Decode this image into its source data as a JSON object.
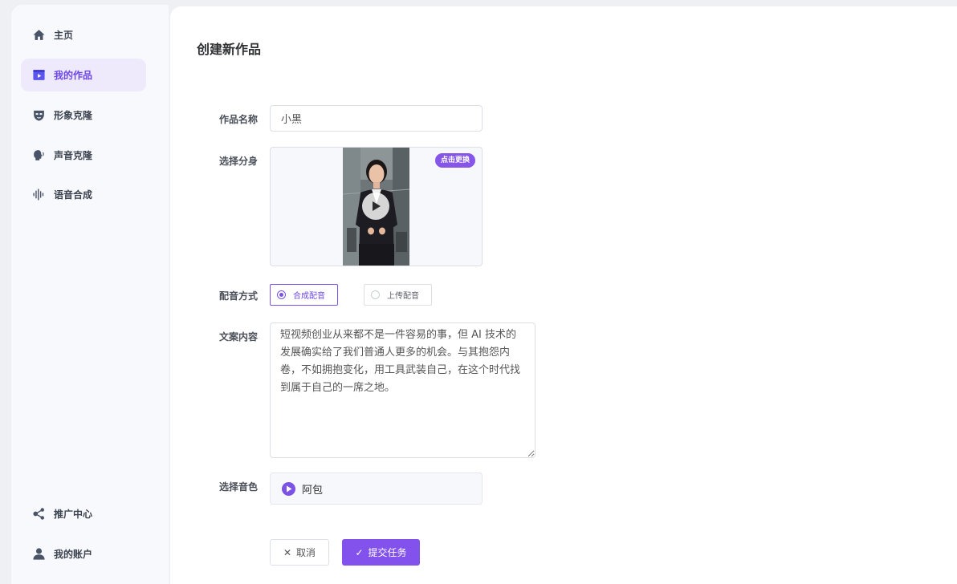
{
  "sidebar": {
    "items": [
      {
        "label": "主页",
        "icon": "home-icon",
        "active": false
      },
      {
        "label": "我的作品",
        "icon": "video-play-icon",
        "active": true
      },
      {
        "label": "形象克隆",
        "icon": "mask-icon",
        "active": false
      },
      {
        "label": "声音克隆",
        "icon": "speaking-head-icon",
        "active": false
      },
      {
        "label": "语音合成",
        "icon": "soundwave-icon",
        "active": false
      }
    ],
    "bottom_items": [
      {
        "label": "推广中心",
        "icon": "share-nodes-icon"
      },
      {
        "label": "我的账户",
        "icon": "user-icon"
      }
    ]
  },
  "main": {
    "title": "创建新作品",
    "form": {
      "name_label": "作品名称",
      "name_value": "小黑",
      "avatar_label": "选择分身",
      "avatar_change": "点击更换",
      "dub_label": "配音方式",
      "dub_options": [
        {
          "label": "合成配音",
          "checked": true
        },
        {
          "label": "上传配音",
          "checked": false
        }
      ],
      "script_label": "文案内容",
      "script_text": "短视频创业从来都不是一件容易的事，但 AI 技术的发展确实给了我们普通人更多的机会。与其抱怨内卷，不如拥抱变化，用工具武装自己，在这个时代找到属于自己的一席之地。",
      "voice_label": "选择音色",
      "voice_name": "阿包"
    },
    "buttons": {
      "cancel": "取消",
      "submit": "提交任务"
    }
  },
  "colors": {
    "accent": "#7b52e5",
    "accent_light_bg": "#efeafb",
    "sidebar_icon": "#4a5468",
    "page_bg": "#eef0f4"
  }
}
